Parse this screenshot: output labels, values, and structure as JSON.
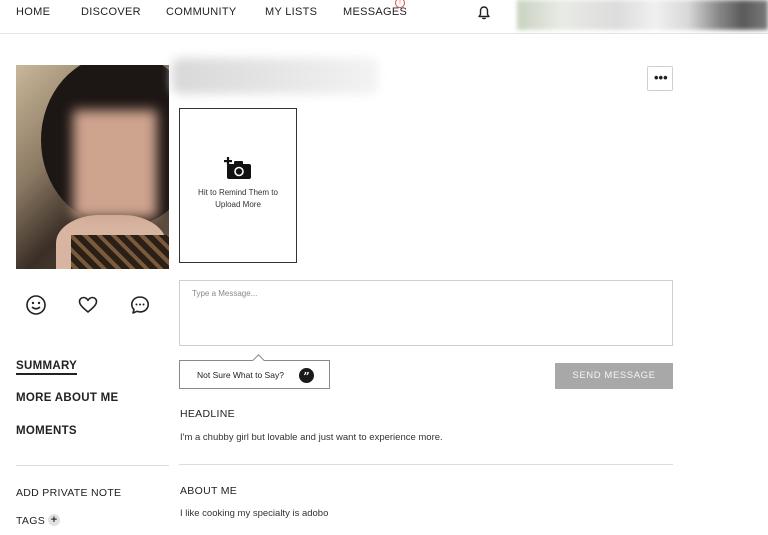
{
  "nav": {
    "items": [
      "HOME",
      "DISCOVER",
      "COMMUNITY",
      "MY LISTS",
      "MESSAGES"
    ],
    "messages_badge": "!",
    "bell_icon": "bell-icon"
  },
  "sidebar": {
    "links": [
      "SUMMARY",
      "MORE ABOUT ME",
      "MOMENTS"
    ],
    "add_private_note": "ADD PRIVATE NOTE",
    "tags": "TAGS",
    "tags_add": "+",
    "action_icons": [
      "smile-icon",
      "heart-icon",
      "chat-icon"
    ]
  },
  "profile": {
    "more_label": "•••",
    "upload_prompt": "Hit to Remind Them to Upload More"
  },
  "message": {
    "placeholder": "Type a Message...",
    "suggest_label": "Not Sure What to Say?",
    "suggest_icon": "”",
    "send_label": "SEND MESSAGE"
  },
  "sections": {
    "headline_title": "HEADLINE",
    "headline_text": "I'm a chubby girl but lovable and just want to experience more.",
    "about_title": "ABOUT ME",
    "about_text": "I like cooking my specialty is adobo"
  },
  "colors": {
    "send_button": "#a8a8a8",
    "badge": "#e05050"
  }
}
